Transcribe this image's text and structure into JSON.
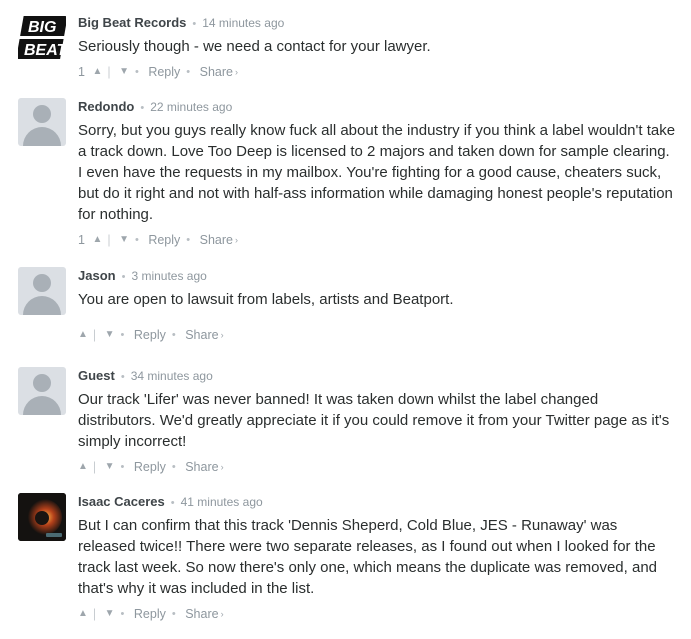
{
  "comments": [
    {
      "author": "Big Beat Records",
      "time": "14 minutes ago",
      "text": "Seriously though - we need a contact for your lawyer.",
      "votes": "1",
      "avatar": "big-beat-logo",
      "logo_text_1": "BIG",
      "logo_text_2": "BEAT",
      "reply_label": "Reply",
      "share_label": "Share"
    },
    {
      "author": "Redondo",
      "time": "22 minutes ago",
      "text": "Sorry, but you guys really know fuck all about the industry if you think a label wouldn't take a track down. Love Too Deep is licensed to 2 majors and taken down for sample clearing. I even have the requests in my mailbox. You're fighting for a good cause, cheaters suck, but do it right and not with half-ass information while damaging honest people's reputation for nothing.",
      "votes": "1",
      "avatar": "default-user",
      "reply_label": "Reply",
      "share_label": "Share"
    },
    {
      "author": "Jason",
      "time": "3 minutes ago",
      "text": "You are open to lawsuit from labels, artists and Beatport.",
      "votes": "",
      "avatar": "default-user",
      "reply_label": "Reply",
      "share_label": "Share"
    },
    {
      "author": "Guest",
      "time": "34 minutes ago",
      "text": "Our track 'Lifer' was never banned! It was taken down whilst the label changed distributors. We'd greatly appreciate it if you could remove it from your Twitter page as it's simply incorrect!",
      "votes": "",
      "avatar": "default-user",
      "reply_label": "Reply",
      "share_label": "Share"
    },
    {
      "author": "Isaac Caceres",
      "time": "41 minutes ago",
      "text": "But I can confirm that this track 'Dennis Sheperd, Cold Blue, JES - Runaway' was released twice!! There were two separate releases, as I found out when I looked for the track last week. So now there's only one, which means the duplicate was removed, and that's why it was included in the list.",
      "votes": "",
      "avatar": "user-photo",
      "reply_label": "Reply",
      "share_label": "Share"
    }
  ],
  "icons": {
    "upvote": "chevron-up-icon",
    "downvote": "chevron-down-icon",
    "share_arrow": "chevron-right-icon"
  },
  "colors": {
    "author": "#3f4549",
    "meta": "#8e979e",
    "text": "#2a2e2e",
    "avatar_bg": "#dbdfe4"
  }
}
